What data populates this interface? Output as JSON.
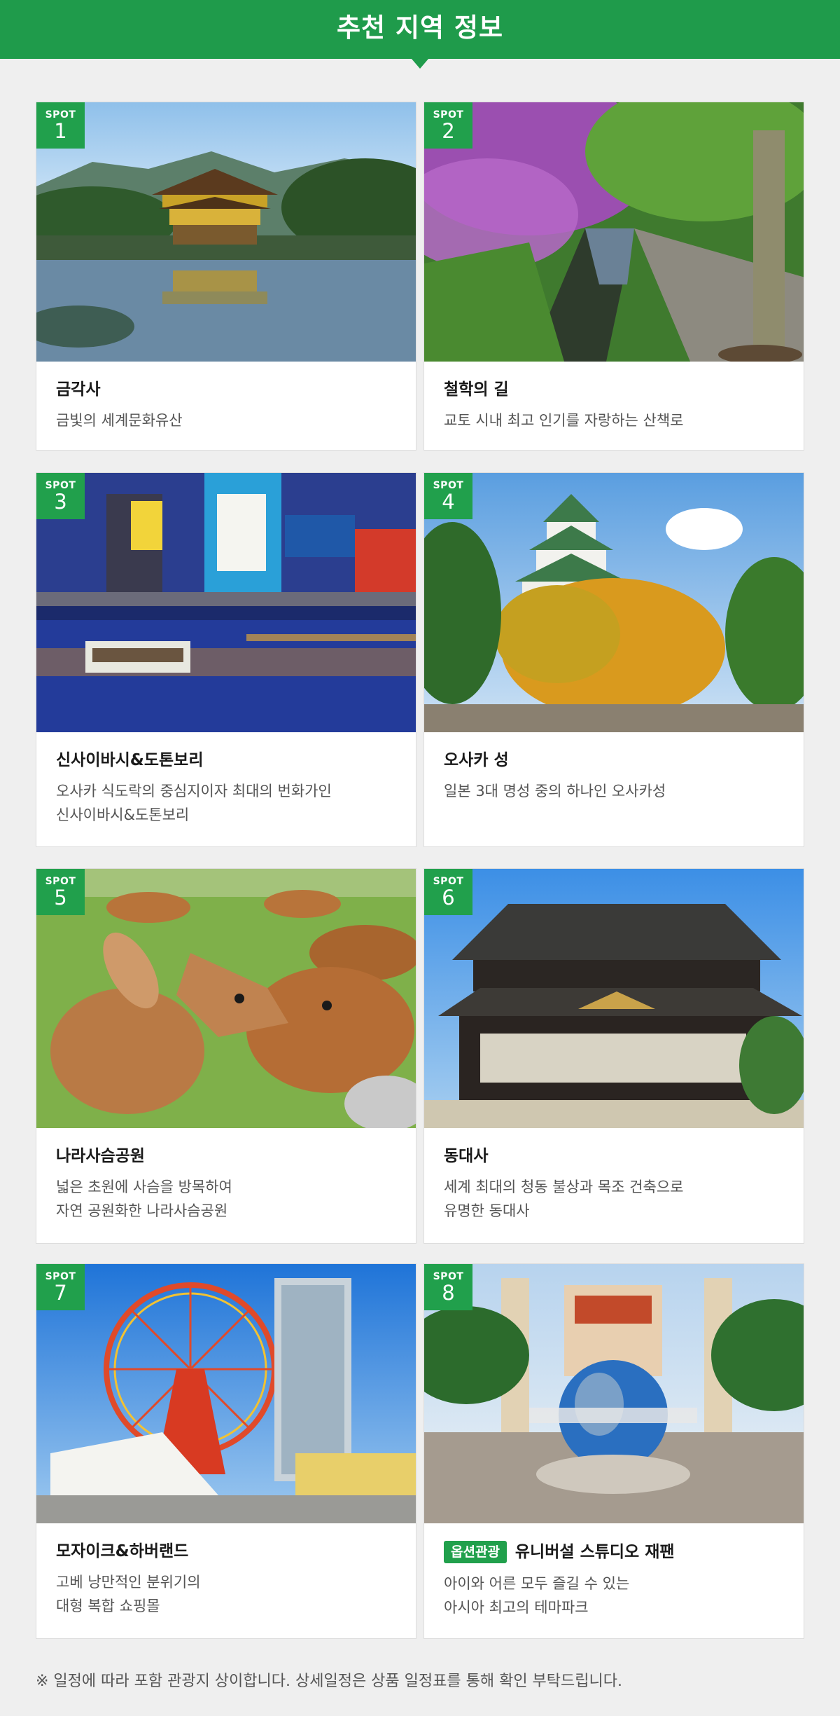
{
  "banner": {
    "title": "추천 지역 정보"
  },
  "spot_label": "SPOT",
  "spots": [
    {
      "num": "1",
      "title": "금각사",
      "desc": "금빛의 세계문화유산",
      "photo": "kinkakuji-golden-pavilion-photo"
    },
    {
      "num": "2",
      "title": "철학의 길",
      "desc": "교토 시내 최고 인기를 자랑하는 산책로",
      "photo": "philosophers-path-photo"
    },
    {
      "num": "3",
      "title": "신사이바시&도톤보리",
      "desc": "오사카 식도락의 중심지이자 최대의 번화가인\n신사이바시&도톤보리",
      "photo": "dotonbori-night-canal-photo"
    },
    {
      "num": "4",
      "title": "오사카 성",
      "desc": "일본 3대 명성 중의 하나인 오사카성",
      "photo": "osaka-castle-photo"
    },
    {
      "num": "5",
      "title": "나라사슴공원",
      "desc": "넓은 초원에 사슴을 방목하여\n자연 공원화한 나라사슴공원",
      "photo": "nara-deer-park-photo"
    },
    {
      "num": "6",
      "title": "동대사",
      "desc": "세계 최대의 청동 불상과 목조 건축으로\n유명한 동대사",
      "photo": "todaiji-temple-photo"
    },
    {
      "num": "7",
      "title": "모자이크&하버랜드",
      "desc": "고베 낭만적인 분위기의\n대형 복합 쇼핑몰",
      "photo": "mosaic-harborland-ferris-wheel-photo"
    },
    {
      "num": "8",
      "title": "유니버설 스튜디오 재팬",
      "badge": "옵션관광",
      "desc": "아이와 어른 모두 즐길 수 있는\n아시아 최고의 테마파크",
      "photo": "universal-studios-globe-photo"
    }
  ],
  "footnote": "※ 일정에 따라 포함 관광지 상이합니다. 상세일정은 상품 일정표를 통해 확인 부탁드립니다.",
  "colors": {
    "accent": "#1f9b4b",
    "spot_badge": "#21a04c",
    "background": "#efefef"
  }
}
